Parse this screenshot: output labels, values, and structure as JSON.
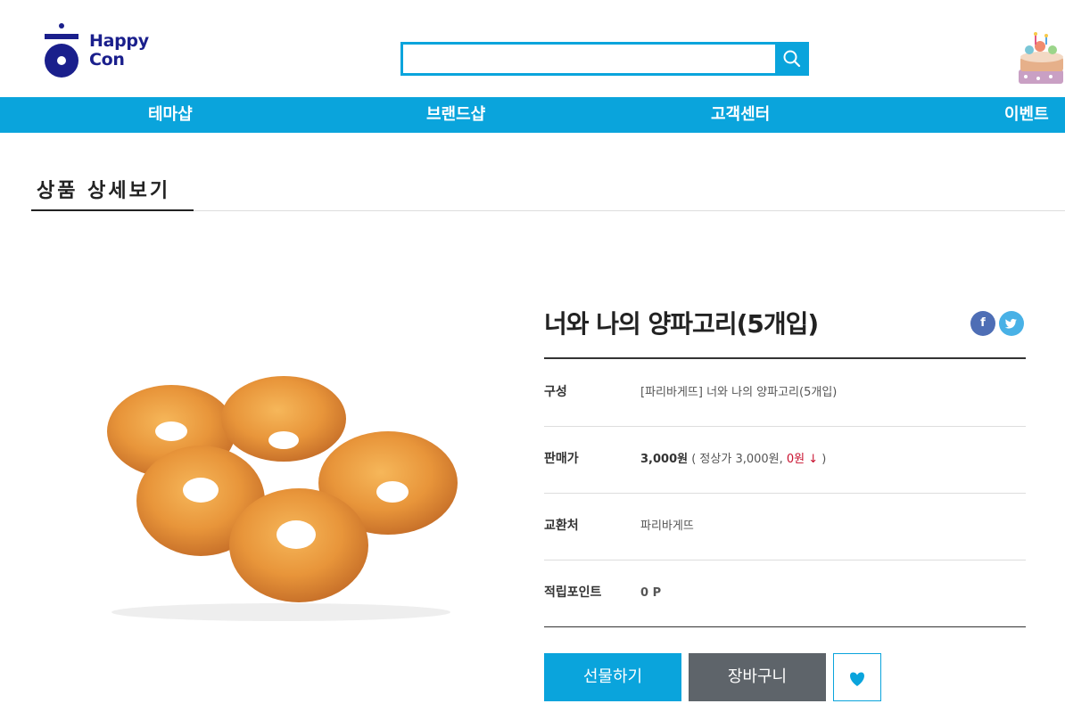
{
  "brand": {
    "logo_text_line1": "Happy",
    "logo_text_line2": "Con",
    "brand_color": "#1a1f8c"
  },
  "search": {
    "value": "",
    "placeholder": "",
    "button_icon": "search-icon"
  },
  "nav": {
    "items": [
      {
        "label": "테마샵"
      },
      {
        "label": "브랜드샵"
      },
      {
        "label": "고객센터"
      },
      {
        "label": "이벤트"
      }
    ],
    "color": "#0aa4dc"
  },
  "page": {
    "title": "상품 상세보기"
  },
  "product": {
    "name": "너와 나의 양파고리(5개입)",
    "social": [
      "facebook-icon",
      "twitter-icon"
    ],
    "info": [
      {
        "label": "구성",
        "value": "[파리바게뜨] 너와 나의 양파고리(5개입)"
      },
      {
        "label": "판매가",
        "price": "3,000원",
        "detail_open": " ( 정상가 3,000원, ",
        "discount": "0원",
        "arrow": "↓",
        "detail_close": " )"
      },
      {
        "label": "교환처",
        "value": "파리바게뜨"
      },
      {
        "label": "적립포인트",
        "value": "0 P"
      }
    ],
    "buttons": {
      "gift": "선물하기",
      "cart": "장바구니",
      "wish_icon": "heart-icon"
    }
  }
}
